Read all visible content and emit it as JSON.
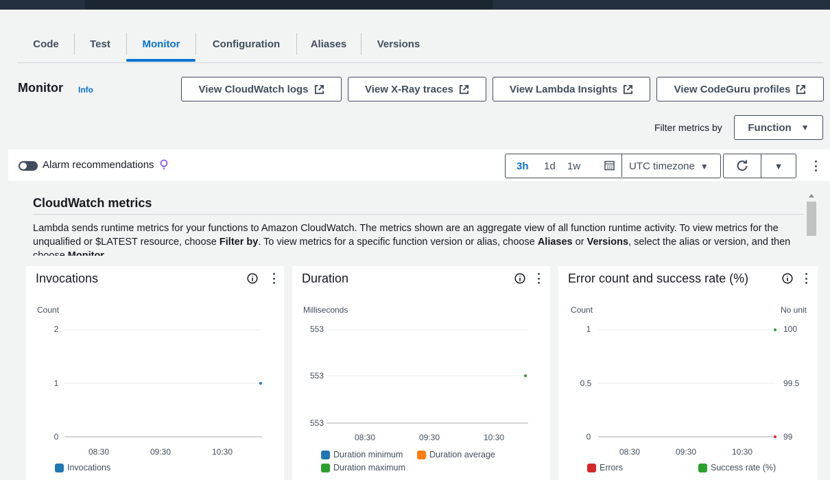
{
  "tabs": [
    {
      "label": "Code"
    },
    {
      "label": "Test"
    },
    {
      "label": "Monitor"
    },
    {
      "label": "Configuration"
    },
    {
      "label": "Aliases"
    },
    {
      "label": "Versions"
    }
  ],
  "active_tab": "Monitor",
  "header": {
    "title": "Monitor",
    "info": "Info",
    "buttons": [
      {
        "label": "View CloudWatch logs"
      },
      {
        "label": "View X-Ray traces"
      },
      {
        "label": "View Lambda Insights"
      },
      {
        "label": "View CodeGuru profiles"
      }
    ]
  },
  "filter": {
    "label": "Filter metrics by",
    "value": "Function"
  },
  "alarm": {
    "label": "Alarm recommendations",
    "enabled": false
  },
  "time_range": {
    "options": [
      "3h",
      "1d",
      "1w"
    ],
    "selected": "3h",
    "timezone": "UTC timezone"
  },
  "cloudwatch": {
    "title": "CloudWatch metrics",
    "desc_1": "Lambda sends runtime metrics for your functions to Amazon CloudWatch. The metrics shown are an aggregate view of all function runtime activity. To view metrics for the unqualified or $LATEST resource, choose ",
    "desc_filter": "Filter by",
    "desc_2": ". To view metrics for a specific function version or alias, choose ",
    "desc_aliases": "Aliases",
    "desc_or": " or ",
    "desc_versions": "Versions",
    "desc_3": ", select the alias or version, and then choose ",
    "desc_monitor": "Monitor",
    "desc_4": "."
  },
  "colors": {
    "accent": "#0972d3",
    "blue_series": "#1f77b4",
    "orange_series": "#ff7f0e",
    "green_series": "#2ca02c",
    "red_series": "#d62728"
  },
  "chart_data": [
    {
      "type": "scatter",
      "title": "Invocations",
      "ylabel": "Count",
      "y_ticks": [
        "2",
        "1",
        "0"
      ],
      "ylim": [
        0,
        2
      ],
      "x_ticks": [
        "08:30",
        "09:30",
        "10:30"
      ],
      "series": [
        {
          "name": "Invocations",
          "color": "#1f77b4",
          "points": [
            {
              "x": "10:55",
              "y": 1
            }
          ]
        }
      ]
    },
    {
      "type": "scatter",
      "title": "Duration",
      "ylabel": "Milliseconds",
      "y_ticks": [
        "553",
        "553",
        "553"
      ],
      "x_ticks": [
        "08:30",
        "09:30",
        "10:30"
      ],
      "series": [
        {
          "name": "Duration minimum",
          "color": "#1f77b4",
          "points": []
        },
        {
          "name": "Duration average",
          "color": "#ff7f0e",
          "points": []
        },
        {
          "name": "Duration maximum",
          "color": "#2ca02c",
          "points": [
            {
              "x": "10:55",
              "y": 553
            }
          ]
        }
      ]
    },
    {
      "type": "scatter",
      "title": "Error count and success rate (%)",
      "ylabel": "Count",
      "y2label": "No unit",
      "y_ticks": [
        "1",
        "0.5",
        "0"
      ],
      "y2_ticks": [
        "100",
        "99.5",
        "99"
      ],
      "ylim": [
        0,
        1
      ],
      "y2lim": [
        99,
        100
      ],
      "x_ticks": [
        "08:30",
        "09:30",
        "10:30"
      ],
      "series": [
        {
          "name": "Errors",
          "color": "#d62728",
          "axis": "left",
          "points": [
            {
              "x": "10:55",
              "y": 0
            }
          ]
        },
        {
          "name": "Success rate (%)",
          "color": "#2ca02c",
          "axis": "right",
          "points": [
            {
              "x": "10:55",
              "y": 100
            }
          ]
        }
      ]
    }
  ]
}
